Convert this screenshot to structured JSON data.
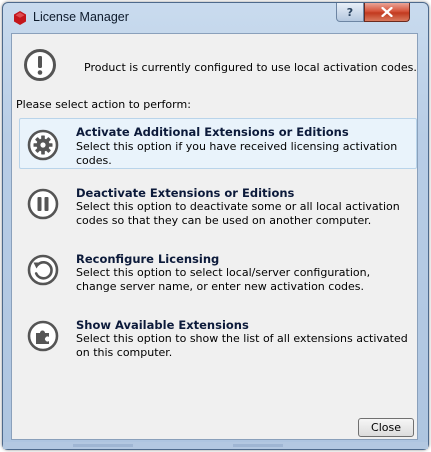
{
  "window": {
    "title": "License Manager",
    "help_label": "?",
    "close_glyph": "✕"
  },
  "info": {
    "icon": "exclamation-circle-icon",
    "text": "Product is currently configured to use local activation codes."
  },
  "prompt": "Please select action to perform:",
  "options": [
    {
      "icon": "gear-icon",
      "title": "Activate Additional Extensions or Editions",
      "desc": "Select this option if you have received licensing activation codes."
    },
    {
      "icon": "pause-icon",
      "title": "Deactivate Extensions or Editions",
      "desc": "Select this option to deactivate some or all local activation codes so that they can be used on another computer."
    },
    {
      "icon": "refresh-icon",
      "title": "Reconfigure Licensing",
      "desc": "Select this option to select local/server configuration, change server name, or enter new activation codes."
    },
    {
      "icon": "puzzle-icon",
      "title": "Show Available Extensions",
      "desc": "Select this option to show the list of all extensions activated on this computer."
    }
  ],
  "close_button": "Close",
  "colors": {
    "icon_gray": "#555555",
    "hover_bg": "#e9f3fb",
    "app_icon": "#c4161c"
  }
}
